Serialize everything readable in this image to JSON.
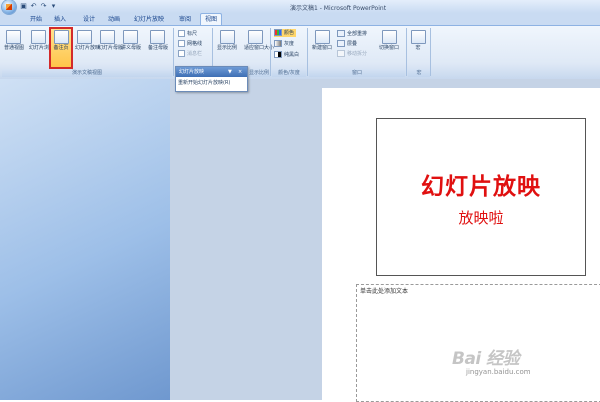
{
  "window": {
    "title": "演示文稿1 - Microsoft PowerPoint"
  },
  "qat": [
    {
      "icon": "save-icon",
      "glyph": "▣"
    },
    {
      "icon": "undo-icon",
      "glyph": "↶"
    },
    {
      "icon": "redo-icon",
      "glyph": "↷"
    },
    {
      "icon": "customize-icon",
      "glyph": "▾"
    }
  ],
  "tabs": [
    "开始",
    "插入",
    "设计",
    "动画",
    "幻灯片放映",
    "审阅",
    "视图"
  ],
  "active_tab": "视图",
  "ribbon": {
    "views": {
      "normal": "普通视图",
      "sorter": "幻灯片浏览",
      "notes": "备注页",
      "slideshow": "幻灯片放映",
      "slide_master": "幻灯片母版",
      "handout_master": "讲义母版",
      "notes_master": "备注母版",
      "group_label": "演示文稿视图"
    },
    "showhide": {
      "ruler": "标尺",
      "gridlines": "网格线",
      "messagebar": "消息栏",
      "group_label": "显示/隐藏"
    },
    "zoom": {
      "zoom": "显示比例",
      "fit": "适应窗口大小",
      "group_label": "显示比例"
    },
    "color": {
      "color": "颜色",
      "grayscale": "灰度",
      "bw": "纯黑白",
      "group_label": "颜色/灰度"
    },
    "window": {
      "new_window": "新建窗口",
      "arrange_all": "全部重排",
      "cascade": "层叠",
      "move_split": "移动拆分",
      "switch_windows": "切换窗口",
      "group_label": "窗口"
    },
    "macros": {
      "macro": "宏",
      "group_label": "宏"
    }
  },
  "popup": {
    "title": "幻灯片放映",
    "item": "重新开始幻灯片放映(R)"
  },
  "slide": {
    "title": "幻灯片放映",
    "subtitle": "放映啦"
  },
  "notes": {
    "placeholder": "单击此处添加文本"
  },
  "watermark": {
    "text": "Bai 经验",
    "url": "jingyan.baidu.com"
  },
  "colors": {
    "accent_red": "#e01010",
    "selected_frame": "#d32a2a"
  }
}
